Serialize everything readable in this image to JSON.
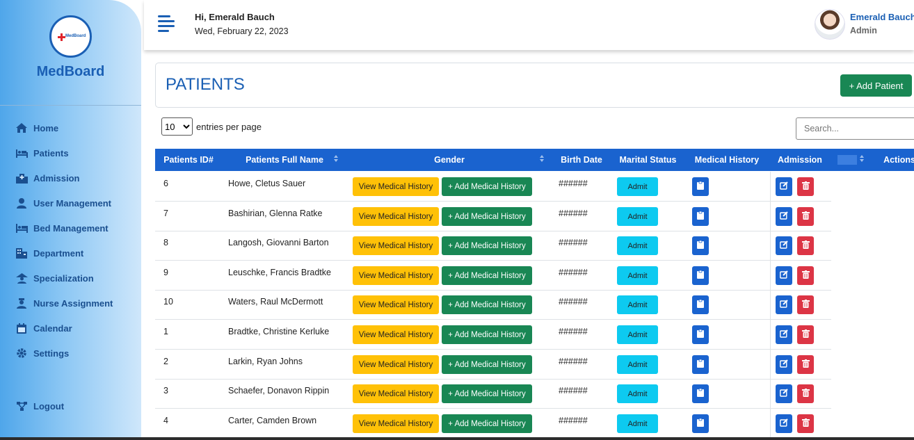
{
  "brand": {
    "name": "MedBoard",
    "logo_text": "MedBoard"
  },
  "sidebar": {
    "items": [
      {
        "label": "Home",
        "icon": "home-icon"
      },
      {
        "label": "Patients",
        "icon": "bed-patient-icon"
      },
      {
        "label": "Admission",
        "icon": "hospital-icon"
      },
      {
        "label": "User Management",
        "icon": "user-icon"
      },
      {
        "label": "Bed Management",
        "icon": "bed-icon"
      },
      {
        "label": "Department",
        "icon": "building-icon"
      },
      {
        "label": "Specialization",
        "icon": "hospital-user-icon"
      },
      {
        "label": "Nurse Assignment",
        "icon": "nurse-icon"
      },
      {
        "label": "Calendar",
        "icon": "calendar-icon"
      },
      {
        "label": "Settings",
        "icon": "gear-icon"
      }
    ],
    "logout": {
      "label": "Logout",
      "icon": "network-icon"
    }
  },
  "header": {
    "greeting": "Hi, Emerald Bauch",
    "date": "Wed, February 22, 2023",
    "user_name": "Emerald Bauch",
    "user_role": "Admin"
  },
  "page": {
    "title": "PATIENTS",
    "add_button": "+ Add Patient",
    "entries_value": "10",
    "entries_label": "entries per page",
    "search_placeholder": "Search..."
  },
  "table": {
    "columns": [
      "Patients ID#",
      "Patients Full Name",
      "Gender",
      "Birth Date",
      "Marital Status",
      "Medical History",
      "Admission",
      "Actions"
    ],
    "view_label": "View Medical History",
    "add_label": "+ Add Medical History",
    "admit_label": "Admit",
    "rows": [
      {
        "id": "6",
        "name": "Howe, Cletus Sauer",
        "birth": "######"
      },
      {
        "id": "7",
        "name": "Bashirian, Glenna Ratke",
        "birth": "######"
      },
      {
        "id": "8",
        "name": "Langosh, Giovanni Barton",
        "birth": "######"
      },
      {
        "id": "9",
        "name": "Leuschke, Francis Bradtke",
        "birth": "######"
      },
      {
        "id": "10",
        "name": "Waters, Raul McDermott",
        "birth": "######"
      },
      {
        "id": "1",
        "name": "Bradtke, Christine Kerluke",
        "birth": "######"
      },
      {
        "id": "2",
        "name": "Larkin, Ryan Johns",
        "birth": "######"
      },
      {
        "id": "3",
        "name": "Schaefer, Donavon Rippin",
        "birth": "######"
      },
      {
        "id": "4",
        "name": "Carter, Camden Brown",
        "birth": "######"
      }
    ]
  },
  "colors": {
    "primary": "#1a63cf",
    "success": "#198754",
    "warning": "#ffc107",
    "info": "#0dcaf0",
    "danger": "#dc3545"
  }
}
